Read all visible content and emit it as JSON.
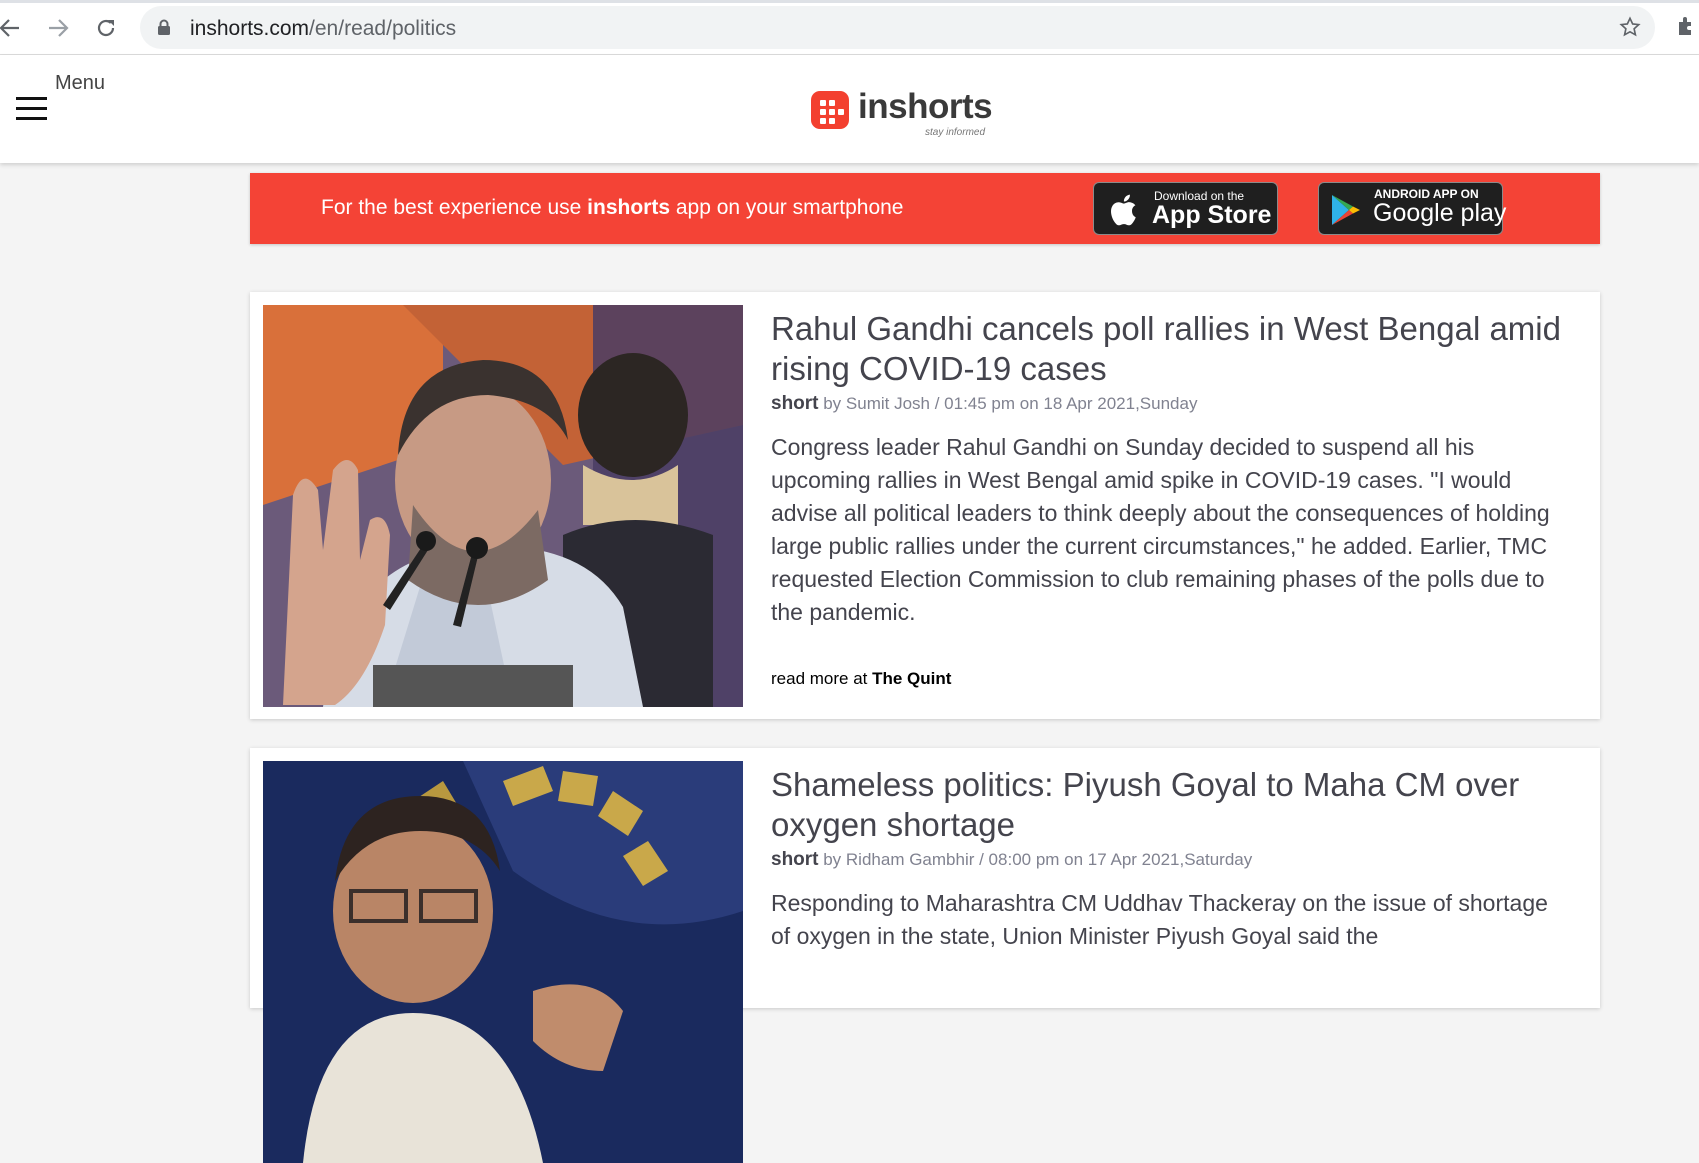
{
  "browser": {
    "url_domain": "inshorts.com",
    "url_path": "/en/read/politics"
  },
  "header": {
    "menu_label": "Menu",
    "logo_text": "inshorts",
    "logo_tagline": "stay informed"
  },
  "banner": {
    "message_prefix": "For the best experience use ",
    "message_brand": "inshorts",
    "message_suffix": " app on your smartphone",
    "app_store_small": "Download on the",
    "app_store_big": "App Store",
    "google_play_small": "ANDROID APP ON",
    "google_play_big": "Google play"
  },
  "articles": [
    {
      "headline": "Rahul Gandhi cancels poll rallies in West Bengal amid rising COVID-19 cases",
      "short_label": "short",
      "byline": " by Sumit Josh / 01:45 pm on 18 Apr 2021,Sunday",
      "content": "Congress leader Rahul Gandhi on Sunday decided to suspend all his upcoming rallies in West Bengal amid spike in COVID-19 cases. \"I would advise all political leaders to think deeply about the consequences of holding large public rallies under the current circumstances,\" he added. Earlier, TMC requested Election Commission to club remaining phases of the polls due to the pandemic.",
      "read_more_prefix": "read more at ",
      "source": "The Quint"
    },
    {
      "headline": "Shameless politics: Piyush Goyal to Maha CM over oxygen shortage",
      "short_label": "short",
      "byline": " by Ridham Gambhir / 08:00 pm on 17 Apr 2021,Saturday",
      "content": "Responding to Maharashtra CM Uddhav Thackeray on the issue of shortage of oxygen in the state, Union Minister Piyush Goyal said the"
    }
  ],
  "colors": {
    "brand_red": "#f44336",
    "text_dark": "#44444d",
    "meta_gray": "#808290"
  }
}
